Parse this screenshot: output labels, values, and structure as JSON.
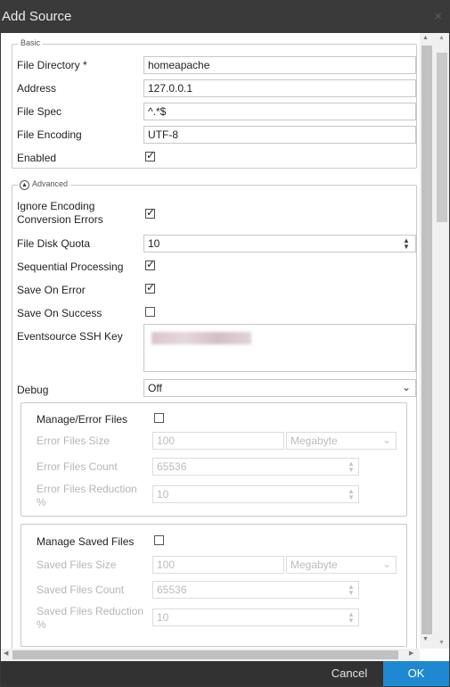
{
  "dialog": {
    "title": "Add Source",
    "close_glyph": "×"
  },
  "basic": {
    "legend": "Basic",
    "file_directory": {
      "label": "File Directory *",
      "value": "homeapache"
    },
    "address": {
      "label": "Address",
      "value": "127.0.0.1"
    },
    "file_spec": {
      "label": "File Spec",
      "value": "^.*$"
    },
    "file_encoding": {
      "label": "File Encoding",
      "value": "UTF-8"
    },
    "enabled": {
      "label": "Enabled",
      "checked": true
    }
  },
  "advanced": {
    "legend": "Advanced",
    "ignore_encoding": {
      "label": "Ignore Encoding Conversion Errors",
      "checked": true
    },
    "file_disk_quota": {
      "label": "File Disk Quota",
      "value": "10"
    },
    "sequential_processing": {
      "label": "Sequential Processing",
      "checked": true
    },
    "save_on_error": {
      "label": "Save On Error",
      "checked": true
    },
    "save_on_success": {
      "label": "Save On Success",
      "checked": false
    },
    "eventsource_ssh_key": {
      "label": "Eventsource SSH Key"
    },
    "debug": {
      "label": "Debug",
      "value": "Off"
    },
    "error_files": {
      "manage_label": "Manage/Error Files",
      "manage_checked": false,
      "size_label": "Error Files Size",
      "size_value": "100",
      "size_unit": "Megabyte",
      "count_label": "Error Files Count",
      "count_value": "65536",
      "reduction_label": "Error Files Reduction %",
      "reduction_value": "10"
    },
    "saved_files": {
      "manage_label": "Manage Saved Files",
      "manage_checked": false,
      "size_label": "Saved Files Size",
      "size_value": "100",
      "size_unit": "Megabyte",
      "count_label": "Saved Files Count",
      "count_value": "65536",
      "reduction_label": "Saved Files Reduction %",
      "reduction_value": "10"
    }
  },
  "footer": {
    "cancel_label": "Cancel",
    "ok_label": "OK"
  },
  "colors": {
    "titlebar": "#3a3a3a",
    "footer": "#323232",
    "ok_button": "#1e88d1"
  }
}
